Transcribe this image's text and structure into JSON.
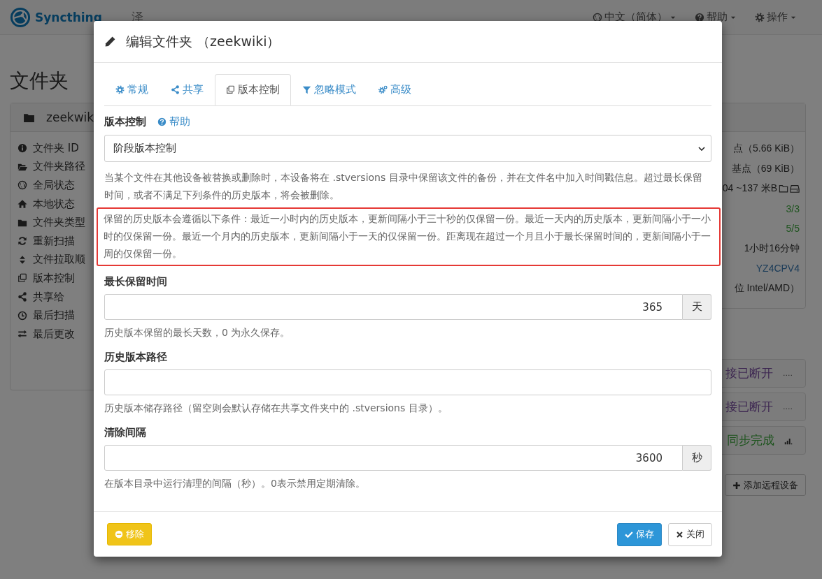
{
  "navbar": {
    "brand": "Syncthing",
    "title": "泽",
    "menus": [
      {
        "label": "中文（简体）"
      },
      {
        "label": "帮助"
      },
      {
        "label": "操作"
      }
    ]
  },
  "heading": "文件夹",
  "folder": {
    "name": "zeekwik",
    "rows": [
      {
        "label": "文件夹 ID"
      },
      {
        "label": "文件夹路径"
      },
      {
        "label": "全局状态"
      },
      {
        "label": "本地状态"
      },
      {
        "label": "文件夹类型"
      },
      {
        "label": "重新扫描"
      },
      {
        "label": "文件拉取顺"
      },
      {
        "label": "版本控制"
      },
      {
        "label": "共享给"
      },
      {
        "label": "最后扫描"
      },
      {
        "label": "最后更改"
      }
    ]
  },
  "device_info": [
    {
      "kind": "text",
      "value": "点（5.66 KiB）"
    },
    {
      "kind": "text",
      "value": "基点（69 KiB）"
    },
    {
      "kind": "storage",
      "value": "04 ~137 米B"
    },
    {
      "kind": "ok",
      "value": "3/3"
    },
    {
      "kind": "ok",
      "value": "5/5"
    },
    {
      "kind": "text",
      "value": "1小时16分钟"
    },
    {
      "kind": "id",
      "value": "YZ4CPV4"
    },
    {
      "kind": "text",
      "value": "位 Intel/AMD）"
    }
  ],
  "devices": [
    {
      "kind": "disconnected",
      "status": "接已断开",
      "extra": "...."
    },
    {
      "kind": "disconnected",
      "status": "接已断开",
      "extra": "...."
    },
    {
      "kind": "synced",
      "status": "同步完成"
    }
  ],
  "add_device": "添加远程设备",
  "modal": {
    "title": "编辑文件夹 （zeekwiki）",
    "tabs": [
      {
        "label": "常规",
        "selected": false
      },
      {
        "label": "共享",
        "selected": false
      },
      {
        "label": "版本控制",
        "selected": true
      },
      {
        "label": "忽略模式",
        "selected": false
      },
      {
        "label": "高级",
        "selected": false
      }
    ],
    "versioning": {
      "label": "版本控制",
      "help_link": "帮助",
      "select": "阶段版本控制",
      "description": "当某个文件在其他设备被替换或删除时，本设备将在 .stversions 目录中保留该文件的备份，并在文件名中加入时间戳信息。超过最长保留时间，或者不满足下列条件的历史版本，将会被删除。",
      "note": "保留的历史版本会遵循以下条件：最近一小时内的历史版本，更新间隔小于三十秒的仅保留一份。最近一天内的历史版本，更新间隔小于一小时的仅保留一份。最近一个月内的历史版本，更新间隔小于一天的仅保留一份。距离现在超过一个月且小于最长保留时间的，更新间隔小于一周的仅保留一份。"
    },
    "fields": [
      {
        "label": "最长保留时间",
        "value": "365",
        "unit": "天",
        "help": "历史版本保留的最长天数，0 为永久保存。"
      },
      {
        "label": "历史版本路径",
        "help": "历史版本储存路径（留空则会默认存储在共享文件夹中的 .stversions 目录）。"
      },
      {
        "label": "清除间隔",
        "value": "3600",
        "unit": "秒",
        "help": "在版本目录中运行清理的间隔（秒）。0表示禁用定期清除。"
      }
    ],
    "buttons": {
      "remove": "移除",
      "save": "保存",
      "close": "关闭"
    }
  }
}
